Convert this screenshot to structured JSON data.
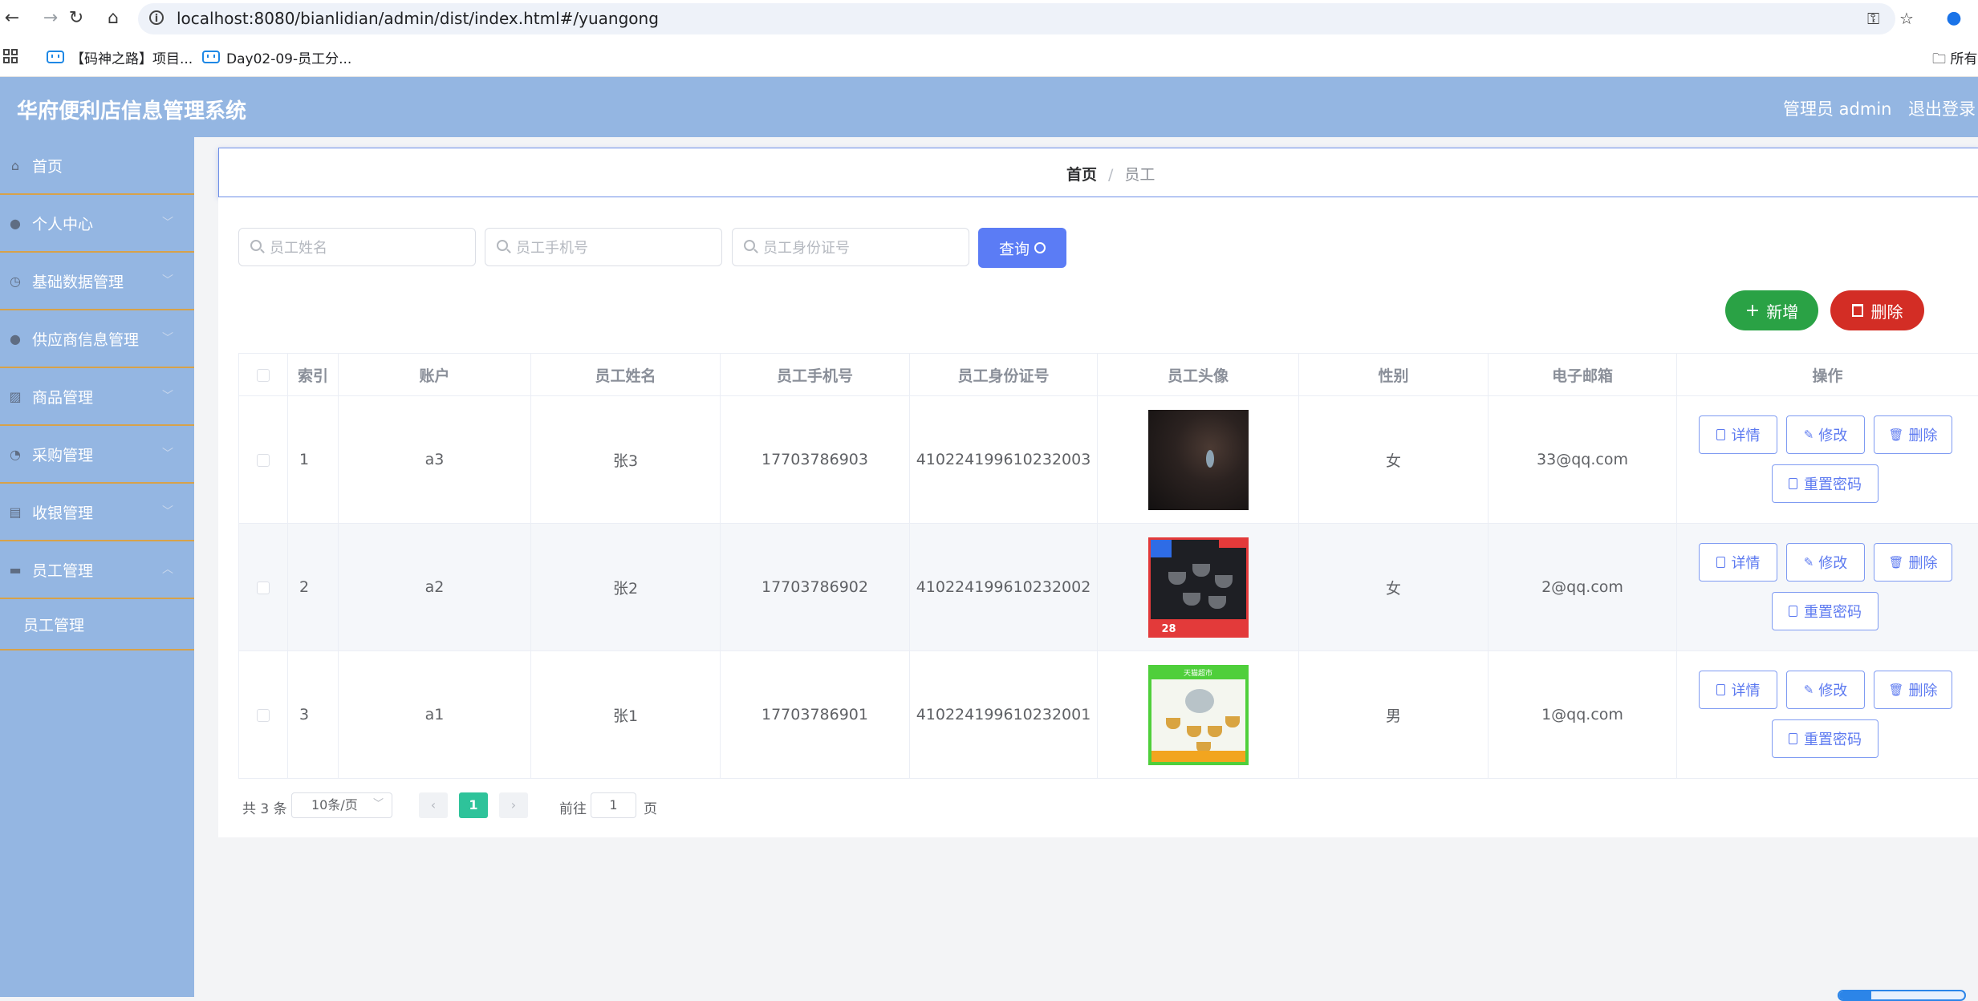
{
  "browser": {
    "url": "localhost:8080/bianlidian/admin/dist/index.html#/yuangong",
    "bookmarks": [
      "【码神之路】项目...",
      "Day02-09-员工分..."
    ],
    "bookmark_folder": "所有"
  },
  "header": {
    "title": "华府便利店信息管理系统",
    "user": "管理员 admin",
    "logout": "退出登录"
  },
  "sidebar": {
    "items": [
      {
        "label": "首页",
        "icon": "home-icon"
      },
      {
        "label": "个人中心",
        "icon": "user-icon"
      },
      {
        "label": "基础数据管理",
        "icon": "clock-icon"
      },
      {
        "label": "供应商信息管理",
        "icon": "user-icon"
      },
      {
        "label": "商品管理",
        "icon": "chart-icon"
      },
      {
        "label": "采购管理",
        "icon": "compass-icon"
      },
      {
        "label": "收银管理",
        "icon": "clipboard-icon"
      },
      {
        "label": "员工管理",
        "icon": "briefcase-icon"
      }
    ],
    "submenu": {
      "label": "员工管理"
    }
  },
  "breadcrumb": {
    "home": "首页",
    "separator": "/",
    "current": "员工"
  },
  "search": {
    "name_placeholder": "员工姓名",
    "phone_placeholder": "员工手机号",
    "id_placeholder": "员工身份证号",
    "query_label": "查询"
  },
  "actions": {
    "add_label": "新增",
    "delete_label": "删除"
  },
  "table": {
    "columns": [
      "索引",
      "账户",
      "员工姓名",
      "员工手机号",
      "员工身份证号",
      "员工头像",
      "性别",
      "电子邮箱",
      "操作"
    ],
    "rows": [
      {
        "index": "1",
        "account": "a3",
        "name": "张3",
        "phone": "17703786903",
        "idcard": "410224199610232003",
        "gender": "女",
        "email": "33@qq.com"
      },
      {
        "index": "2",
        "account": "a2",
        "name": "张2",
        "phone": "17703786902",
        "idcard": "410224199610232002",
        "gender": "女",
        "email": "2@qq.com"
      },
      {
        "index": "3",
        "account": "a1",
        "name": "张1",
        "phone": "17703786901",
        "idcard": "410224199610232001",
        "gender": "男",
        "email": "1@qq.com"
      }
    ],
    "row_actions": {
      "detail": "详情",
      "edit": "修改",
      "delete": "删除",
      "reset": "重置密码"
    },
    "avatar_texts": {
      "badge_number": "28",
      "banner": "天猫超市"
    }
  },
  "pagination": {
    "total": "共 3 条",
    "page_size": "10条/页",
    "current": "1",
    "goto_prefix": "前往",
    "goto_value": "1",
    "goto_suffix": "页"
  },
  "colors": {
    "header_bg": "#94b6e2",
    "primary": "#5b7cf5",
    "success": "#2aa245",
    "danger": "#d32d25",
    "pager_active": "#2ec39a"
  }
}
